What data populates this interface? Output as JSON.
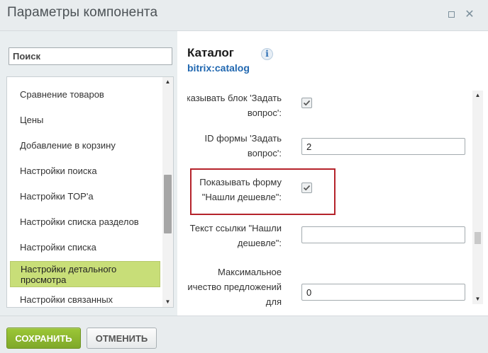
{
  "window": {
    "title": "Параметры компонента"
  },
  "sidebar": {
    "search_placeholder": "Поиск",
    "items": [
      {
        "label": "Сравнение товаров"
      },
      {
        "label": "Цены"
      },
      {
        "label": "Добавление в корзину"
      },
      {
        "label": "Настройки поиска"
      },
      {
        "label": "Настройки TOP'а"
      },
      {
        "label": "Настройки списка разделов"
      },
      {
        "label": "Настройки списка"
      },
      {
        "label": "Настройки детального просмотра"
      },
      {
        "label": "Настройки связанных"
      }
    ],
    "active_index": 7
  },
  "component": {
    "title": "Каталог",
    "code": "bitrix:catalog",
    "info_icon": "info-icon"
  },
  "params": {
    "show_ask_block": {
      "label": "Показывать блок 'Задать вопрос':",
      "checked": true
    },
    "ask_form_id": {
      "label": "ID формы 'Задать вопрос':",
      "value": "2"
    },
    "show_cheaper_form": {
      "label": "Показывать форму \"Нашли дешевле\":",
      "checked": true
    },
    "cheaper_link_text": {
      "label": "Текст ссылки \"Нашли дешевле\":",
      "value": ""
    },
    "max_offers": {
      "label": "Максимальное количество предложений для",
      "value": "0"
    }
  },
  "footer": {
    "save_label": "СОХРАНИТЬ",
    "cancel_label": "ОТМЕНИТЬ"
  },
  "colors": {
    "accent_green": "#8ab52f",
    "active_item": "#c8de78",
    "highlight_red": "#b5232b",
    "link_blue": "#2067b0"
  }
}
